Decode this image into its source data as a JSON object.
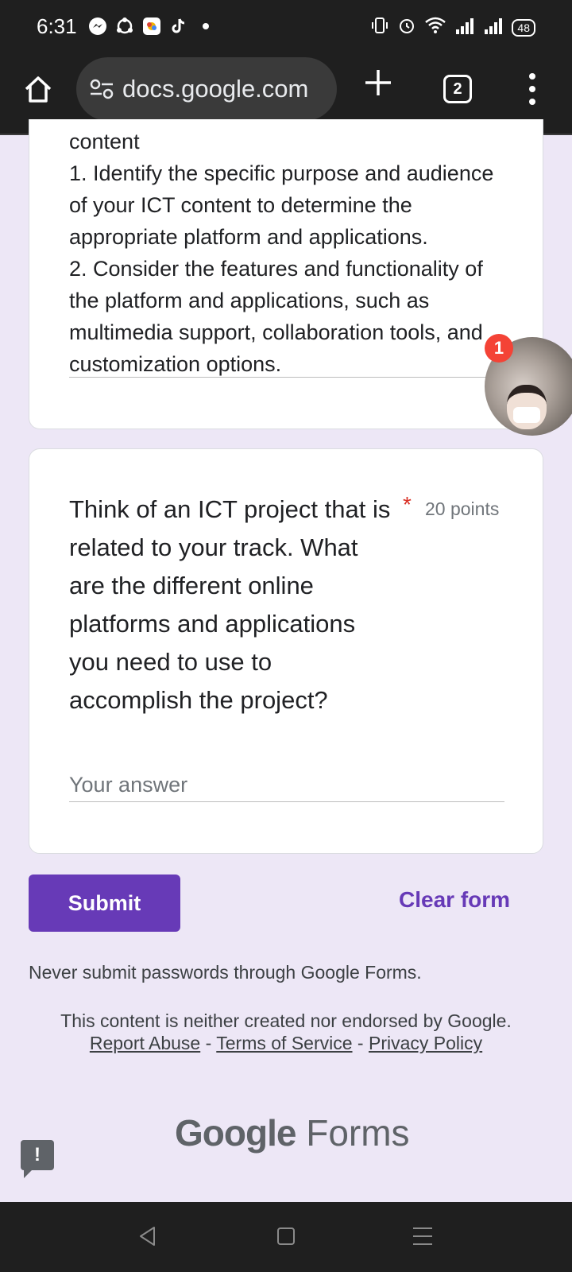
{
  "status_bar": {
    "time": "6:31",
    "battery": "48",
    "app_icons": [
      "messenger-icon",
      "sync-icon",
      "photos-icon",
      "tiktok-icon",
      "dot-icon"
    ]
  },
  "browser": {
    "url": "docs.google.com",
    "tab_count": "2"
  },
  "previous_answer": {
    "text": "content\n1. Identify the specific purpose and audience of your ICT content to determine the appropriate platform and applications.\n2. Consider the features and functionality of the platform and applications, such as multimedia support, collaboration tools, and customization options."
  },
  "question": {
    "text": "Think of an ICT project that is related to your track. What are the different online platforms and applications you need to use to accomplish the project?",
    "required_marker": "*",
    "points": "20 points",
    "answer_placeholder": "Your answer"
  },
  "actions": {
    "submit_label": "Submit",
    "clear_label": "Clear form"
  },
  "footer": {
    "warning": "Never submit passwords through Google Forms.",
    "disclaimer_prefix": "This content is neither created nor endorsed by Google.",
    "report_abuse": "Report Abuse",
    "sep": "-",
    "terms": "Terms of Service",
    "privacy": "Privacy Policy",
    "logo_google": "Google",
    "logo_forms": "Forms"
  },
  "chat_head": {
    "badge": "1"
  },
  "colors": {
    "accent": "#673ab7",
    "background": "#ede7f6",
    "required": "#d93025",
    "badge": "#f44336"
  }
}
